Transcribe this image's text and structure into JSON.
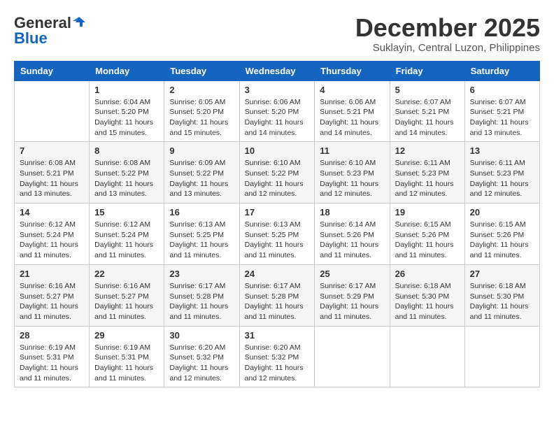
{
  "header": {
    "logo_general": "General",
    "logo_blue": "Blue",
    "month_title": "December 2025",
    "location": "Suklayin, Central Luzon, Philippines"
  },
  "weekdays": [
    "Sunday",
    "Monday",
    "Tuesday",
    "Wednesday",
    "Thursday",
    "Friday",
    "Saturday"
  ],
  "weeks": [
    [
      {
        "day": "",
        "info": ""
      },
      {
        "day": "1",
        "info": "Sunrise: 6:04 AM\nSunset: 5:20 PM\nDaylight: 11 hours\nand 15 minutes."
      },
      {
        "day": "2",
        "info": "Sunrise: 6:05 AM\nSunset: 5:20 PM\nDaylight: 11 hours\nand 15 minutes."
      },
      {
        "day": "3",
        "info": "Sunrise: 6:06 AM\nSunset: 5:20 PM\nDaylight: 11 hours\nand 14 minutes."
      },
      {
        "day": "4",
        "info": "Sunrise: 6:06 AM\nSunset: 5:21 PM\nDaylight: 11 hours\nand 14 minutes."
      },
      {
        "day": "5",
        "info": "Sunrise: 6:07 AM\nSunset: 5:21 PM\nDaylight: 11 hours\nand 14 minutes."
      },
      {
        "day": "6",
        "info": "Sunrise: 6:07 AM\nSunset: 5:21 PM\nDaylight: 11 hours\nand 13 minutes."
      }
    ],
    [
      {
        "day": "7",
        "info": "Sunrise: 6:08 AM\nSunset: 5:21 PM\nDaylight: 11 hours\nand 13 minutes."
      },
      {
        "day": "8",
        "info": "Sunrise: 6:08 AM\nSunset: 5:22 PM\nDaylight: 11 hours\nand 13 minutes."
      },
      {
        "day": "9",
        "info": "Sunrise: 6:09 AM\nSunset: 5:22 PM\nDaylight: 11 hours\nand 13 minutes."
      },
      {
        "day": "10",
        "info": "Sunrise: 6:10 AM\nSunset: 5:22 PM\nDaylight: 11 hours\nand 12 minutes."
      },
      {
        "day": "11",
        "info": "Sunrise: 6:10 AM\nSunset: 5:23 PM\nDaylight: 11 hours\nand 12 minutes."
      },
      {
        "day": "12",
        "info": "Sunrise: 6:11 AM\nSunset: 5:23 PM\nDaylight: 11 hours\nand 12 minutes."
      },
      {
        "day": "13",
        "info": "Sunrise: 6:11 AM\nSunset: 5:23 PM\nDaylight: 11 hours\nand 12 minutes."
      }
    ],
    [
      {
        "day": "14",
        "info": "Sunrise: 6:12 AM\nSunset: 5:24 PM\nDaylight: 11 hours\nand 11 minutes."
      },
      {
        "day": "15",
        "info": "Sunrise: 6:12 AM\nSunset: 5:24 PM\nDaylight: 11 hours\nand 11 minutes."
      },
      {
        "day": "16",
        "info": "Sunrise: 6:13 AM\nSunset: 5:25 PM\nDaylight: 11 hours\nand 11 minutes."
      },
      {
        "day": "17",
        "info": "Sunrise: 6:13 AM\nSunset: 5:25 PM\nDaylight: 11 hours\nand 11 minutes."
      },
      {
        "day": "18",
        "info": "Sunrise: 6:14 AM\nSunset: 5:26 PM\nDaylight: 11 hours\nand 11 minutes."
      },
      {
        "day": "19",
        "info": "Sunrise: 6:15 AM\nSunset: 5:26 PM\nDaylight: 11 hours\nand 11 minutes."
      },
      {
        "day": "20",
        "info": "Sunrise: 6:15 AM\nSunset: 5:26 PM\nDaylight: 11 hours\nand 11 minutes."
      }
    ],
    [
      {
        "day": "21",
        "info": "Sunrise: 6:16 AM\nSunset: 5:27 PM\nDaylight: 11 hours\nand 11 minutes."
      },
      {
        "day": "22",
        "info": "Sunrise: 6:16 AM\nSunset: 5:27 PM\nDaylight: 11 hours\nand 11 minutes."
      },
      {
        "day": "23",
        "info": "Sunrise: 6:17 AM\nSunset: 5:28 PM\nDaylight: 11 hours\nand 11 minutes."
      },
      {
        "day": "24",
        "info": "Sunrise: 6:17 AM\nSunset: 5:28 PM\nDaylight: 11 hours\nand 11 minutes."
      },
      {
        "day": "25",
        "info": "Sunrise: 6:17 AM\nSunset: 5:29 PM\nDaylight: 11 hours\nand 11 minutes."
      },
      {
        "day": "26",
        "info": "Sunrise: 6:18 AM\nSunset: 5:30 PM\nDaylight: 11 hours\nand 11 minutes."
      },
      {
        "day": "27",
        "info": "Sunrise: 6:18 AM\nSunset: 5:30 PM\nDaylight: 11 hours\nand 11 minutes."
      }
    ],
    [
      {
        "day": "28",
        "info": "Sunrise: 6:19 AM\nSunset: 5:31 PM\nDaylight: 11 hours\nand 11 minutes."
      },
      {
        "day": "29",
        "info": "Sunrise: 6:19 AM\nSunset: 5:31 PM\nDaylight: 11 hours\nand 11 minutes."
      },
      {
        "day": "30",
        "info": "Sunrise: 6:20 AM\nSunset: 5:32 PM\nDaylight: 11 hours\nand 12 minutes."
      },
      {
        "day": "31",
        "info": "Sunrise: 6:20 AM\nSunset: 5:32 PM\nDaylight: 11 hours\nand 12 minutes."
      },
      {
        "day": "",
        "info": ""
      },
      {
        "day": "",
        "info": ""
      },
      {
        "day": "",
        "info": ""
      }
    ]
  ]
}
